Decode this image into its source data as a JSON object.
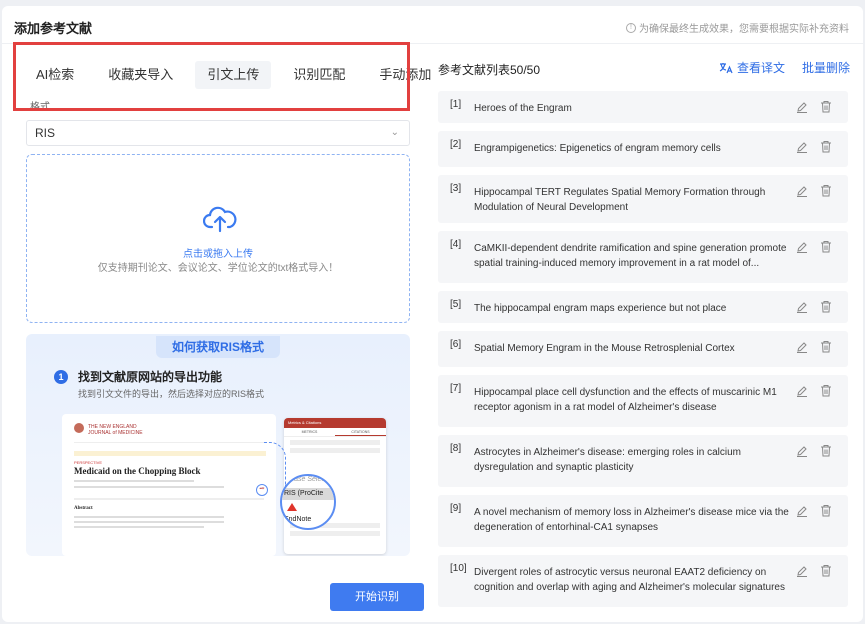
{
  "dialog": {
    "title": "添加参考文献",
    "hint": "为确保最终生成效果，您需要根据实际补充资料"
  },
  "tabs": [
    {
      "label": "AI检索",
      "active": false
    },
    {
      "label": "收藏夹导入",
      "active": false
    },
    {
      "label": "引文上传",
      "active": true
    },
    {
      "label": "识别匹配",
      "active": false
    },
    {
      "label": "手动添加",
      "active": false
    }
  ],
  "format": {
    "label": "格式",
    "value": "RIS"
  },
  "upload": {
    "main": "点击或拖入上传",
    "sub": "仅支持期刊论文、会议论文、学位论文的txt格式导入！"
  },
  "guide": {
    "title": "如何获取RIS格式",
    "step_number": "1",
    "step_title": "找到文献原网站的导出功能",
    "step_desc": "找到引文文件的导出，然后选择对应的RIS格式",
    "screenshot_journal_line1": "THE NEW ENGLAND",
    "screenshot_journal_line2": "JOURNAL of MEDICINE",
    "screenshot_section": "PERSPECTIVE",
    "screenshot_headline": "Medicaid on the Chopping Block",
    "screenshot_abstract": "Abstract",
    "popup_header": "Metrics & Citations",
    "popup_tab1": "METRICS",
    "popup_tab2": "CITATIONS",
    "zoom_placeholder": "Please Select",
    "zoom_option1": "RIS (ProCite",
    "zoom_option2": "EndNote",
    "cite_glyph": "❝❞"
  },
  "actions": {
    "start": "开始识别"
  },
  "references": {
    "title": "参考文献列表50/50",
    "view_translation": "查看译文",
    "batch_delete": "批量删除",
    "items": [
      {
        "num": "[1]",
        "text": "Heroes of the Engram"
      },
      {
        "num": "[2]",
        "text": "Engrampigenetics: Epigenetics of engram memory cells"
      },
      {
        "num": "[3]",
        "text": "Hippocampal TERT Regulates Spatial Memory Formation through Modulation of Neural Development"
      },
      {
        "num": "[4]",
        "text": "CaMKII-dependent dendrite ramification and spine generation promote spatial training-induced memory improvement in a rat model of..."
      },
      {
        "num": "[5]",
        "text": "The hippocampal engram maps experience but not place"
      },
      {
        "num": "[6]",
        "text": "Spatial Memory Engram in the Mouse Retrosplenial Cortex"
      },
      {
        "num": "[7]",
        "text": "Hippocampal place cell dysfunction and the effects of muscarinic M1 receptor agonism in a rat model of Alzheimer's disease"
      },
      {
        "num": "[8]",
        "text": "Astrocytes in Alzheimer's disease: emerging roles in calcium dysregulation and synaptic plasticity"
      },
      {
        "num": "[9]",
        "text": "A novel mechanism of memory loss in Alzheimer's disease mice via the degeneration of entorhinal-CA1 synapses"
      },
      {
        "num": "[10]",
        "text": "Divergent roles of astrocytic versus neuronal EAAT2 deficiency on cognition and overlap with aging and Alzheimer's molecular signatures"
      }
    ]
  },
  "colors": {
    "accent": "#3f7bf0",
    "highlight": "#e2403f",
    "link": "#2f6de5"
  }
}
